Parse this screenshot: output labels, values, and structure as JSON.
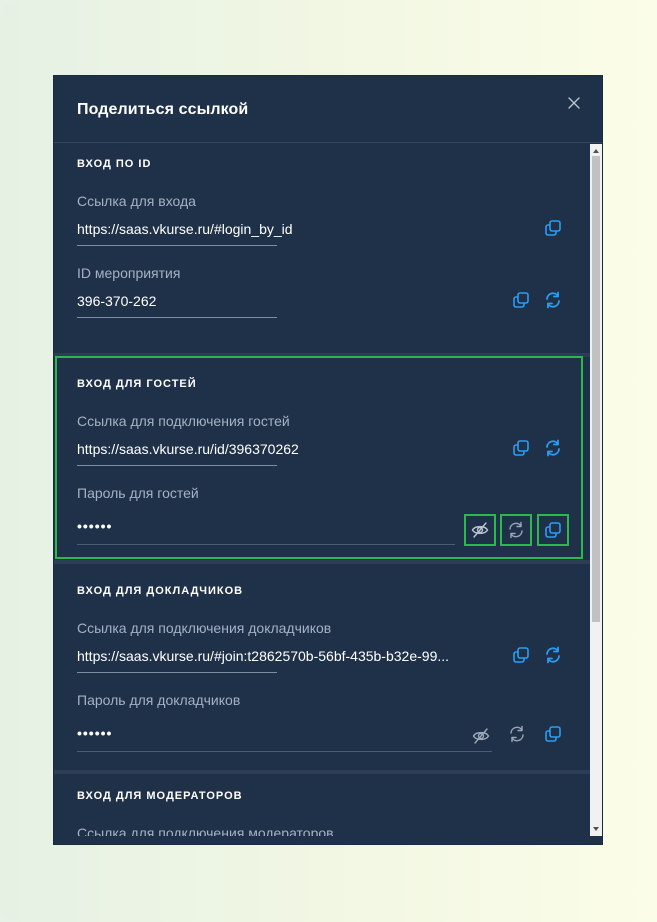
{
  "modal": {
    "title": "Поделиться ссылкой"
  },
  "sections": {
    "by_id": {
      "title": "ВХОД ПО ID",
      "link_label": "Ссылка для входа",
      "link_value": "https://saas.vkurse.ru/#login_by_id",
      "id_label": "ID мероприятия",
      "id_value": "396-370-262"
    },
    "guests": {
      "title": "ВХОД ДЛЯ ГОСТЕЙ",
      "link_label": "Ссылка для подключения гостей",
      "link_value": "https://saas.vkurse.ru/id/396370262",
      "password_label": "Пароль для гостей",
      "password_value": "••••••"
    },
    "speakers": {
      "title": "ВХОД ДЛЯ ДОКЛАДЧИКОВ",
      "link_label": "Ссылка для подключения докладчиков",
      "link_value": "https://saas.vkurse.ru/#join:t2862570b-56bf-435b-b32e-99...",
      "password_label": "Пароль для докладчиков",
      "password_value": "••••••"
    },
    "moderators": {
      "title": "ВХОД ДЛЯ МОДЕРАТОРОВ",
      "link_label": "Ссылка для подключения модераторов"
    }
  },
  "colors": {
    "modal_bg": "#1f3149",
    "accent_blue": "#2a9df4",
    "highlight_green": "#2db84d",
    "muted_icon": "#9aa7b8"
  },
  "icons": {
    "close": "close-icon",
    "copy": "copy-icon",
    "refresh": "refresh-icon",
    "hide": "eye-off-icon"
  }
}
